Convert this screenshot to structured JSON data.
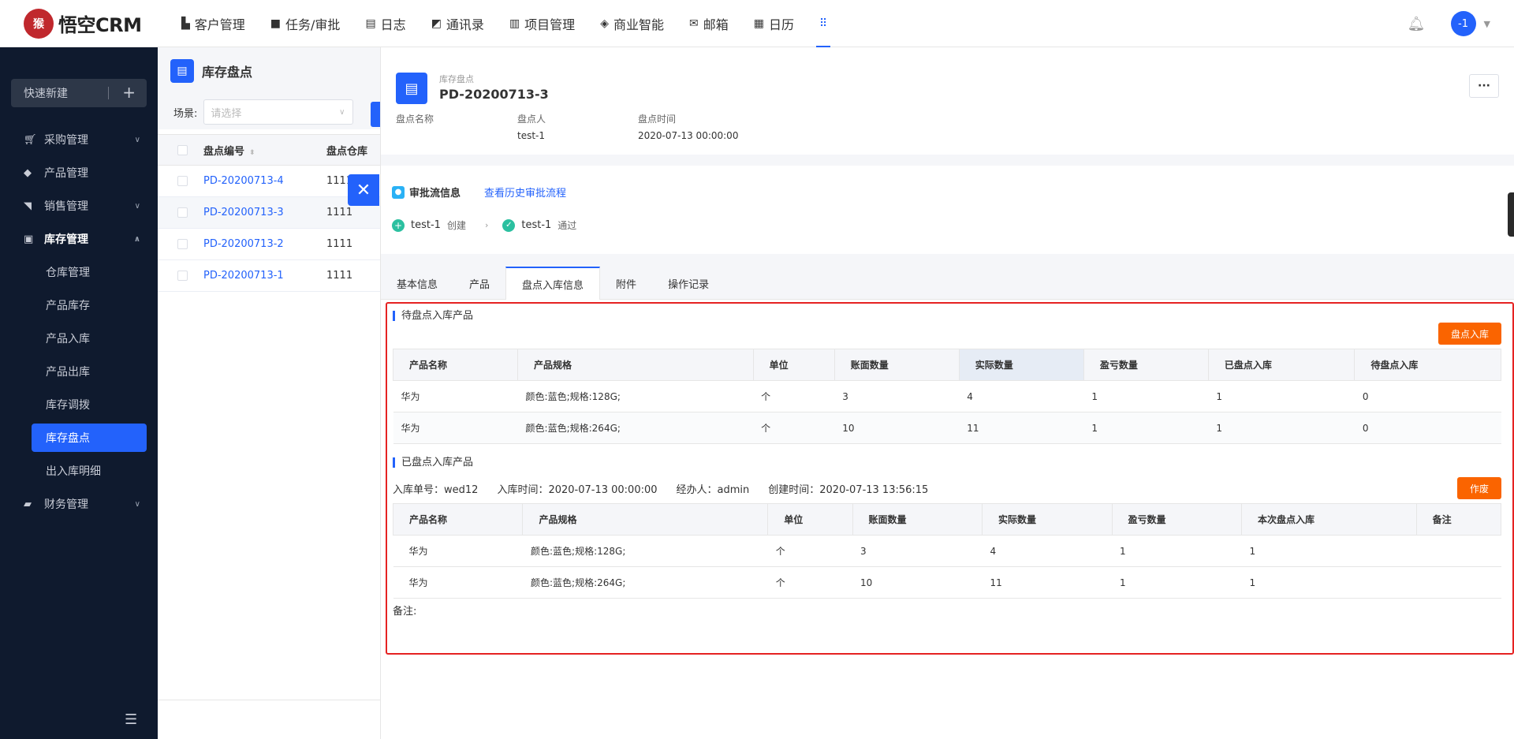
{
  "app": {
    "logo_text": "悟空CRM",
    "logo_mark": "猴"
  },
  "nav": [
    {
      "label": "客户管理",
      "icon": "building-icon"
    },
    {
      "label": "任务/审批",
      "icon": "briefcase-icon"
    },
    {
      "label": "日志",
      "icon": "log-icon"
    },
    {
      "label": "通讯录",
      "icon": "phone-book-icon"
    },
    {
      "label": "项目管理",
      "icon": "project-icon"
    },
    {
      "label": "商业智能",
      "icon": "bi-icon"
    },
    {
      "label": "邮箱",
      "icon": "mail-icon"
    },
    {
      "label": "日历",
      "icon": "calendar-icon"
    }
  ],
  "user": {
    "avatar_text": "-1"
  },
  "sidebar": {
    "quick_new": "快速新建",
    "items": [
      {
        "label": "采购管理"
      },
      {
        "label": "产品管理"
      },
      {
        "label": "销售管理"
      },
      {
        "label": "库存管理"
      },
      {
        "label": "财务管理"
      }
    ],
    "sub_items": [
      "仓库管理",
      "产品库存",
      "产品入库",
      "产品出库",
      "库存调拨",
      "库存盘点",
      "出入库明细"
    ]
  },
  "list": {
    "title": "库存盘点",
    "filter_label": "场景:",
    "filter_placeholder": "请选择",
    "col_code": "盘点编号",
    "col_warehouse": "盘点仓库",
    "rows": [
      {
        "code": "PD-20200713-4",
        "warehouse": "1111"
      },
      {
        "code": "PD-20200713-3",
        "warehouse": "1111"
      },
      {
        "code": "PD-20200713-2",
        "warehouse": "1111"
      },
      {
        "code": "PD-20200713-1",
        "warehouse": "1111"
      }
    ]
  },
  "detail": {
    "type_label": "库存盘点",
    "code": "PD-20200713-3",
    "more_label": "···",
    "meta": [
      {
        "label": "盘点名称",
        "value": ""
      },
      {
        "label": "盘点人",
        "value": "test-1"
      },
      {
        "label": "盘点时间",
        "value": "2020-07-13 00:00:00"
      }
    ],
    "approval": {
      "title": "审批流信息",
      "history_link": "查看历史审批流程",
      "step1_user": "test-1",
      "step1_status": "创建",
      "step2_user": "test-1",
      "step2_status": "通过"
    },
    "tabs": [
      "基本信息",
      "产品",
      "盘点入库信息",
      "附件",
      "操作记录"
    ],
    "pending": {
      "title": "待盘点入库产品",
      "button": "盘点入库",
      "headers": [
        "产品名称",
        "产品规格",
        "单位",
        "账面数量",
        "实际数量",
        "盈亏数量",
        "已盘点入库",
        "待盘点入库"
      ],
      "rows": [
        [
          "华为",
          "颜色:蓝色;规格:128G;",
          "个",
          "3",
          "4",
          "1",
          "1",
          "0"
        ],
        [
          "华为",
          "颜色:蓝色;规格:264G;",
          "个",
          "10",
          "11",
          "1",
          "1",
          "0"
        ]
      ]
    },
    "done": {
      "title": "已盘点入库产品",
      "button": "作废",
      "info": {
        "order_no": "入库单号：wed12",
        "stock_time": "入库时间：2020-07-13 00:00:00",
        "handler": "经办人：admin",
        "created": "创建时间：2020-07-13 13:56:15"
      },
      "headers": [
        "产品名称",
        "产品规格",
        "单位",
        "账面数量",
        "实际数量",
        "盈亏数量",
        "本次盘点入库",
        "备注"
      ],
      "rows": [
        [
          "华为",
          "颜色:蓝色;规格:128G;",
          "个",
          "3",
          "4",
          "1",
          "1",
          ""
        ],
        [
          "华为",
          "颜色:蓝色;规格:264G;",
          "个",
          "10",
          "11",
          "1",
          "1",
          ""
        ]
      ],
      "remark_label": "备注:"
    }
  }
}
